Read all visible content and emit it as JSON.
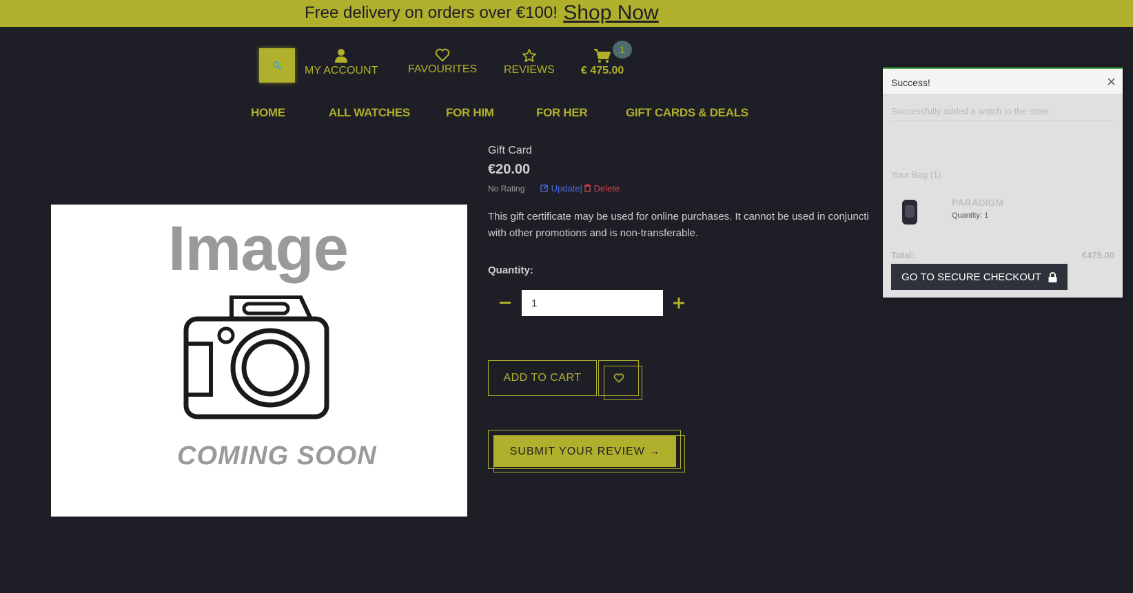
{
  "banner": {
    "text": "Free delivery on orders over €100!",
    "link": "Shop Now"
  },
  "header": {
    "search_icon": "search-icon",
    "my_account": "MY ACCOUNT",
    "favourites": "FAVOURITES",
    "reviews": "REVIEWS",
    "cart_total": "€ 475.00",
    "cart_count": "1"
  },
  "nav": {
    "items": [
      "HOME",
      "ALL WATCHES",
      "FOR HIM",
      "FOR HER",
      "GIFT CARDS & DEALS"
    ]
  },
  "image": {
    "word": "Image",
    "coming_soon": "COMING SOON"
  },
  "product": {
    "name": "Gift Card",
    "price": "€20.00",
    "rating": "No Rating",
    "update": "Update",
    "separator": "|",
    "delete": "Delete",
    "description": "This gift certificate may be used for online purchases. It cannot be used in conjuncti",
    "description_line2": "with other promotions and is non-transferable.",
    "quantity_label": "Quantity:",
    "quantity_value": "1",
    "add_to_cart": "ADD TO CART",
    "submit_review": "SUBMIT YOUR REVIEW →"
  },
  "toast": {
    "title": "Success!",
    "close": "×",
    "message": "Successfully added a watch to the store",
    "bag": "Your Bag (1)",
    "item_name": "PARADIGM",
    "item_qty": "Quantity: 1",
    "total_label": "Total:",
    "total_value": "€475.00",
    "checkout": "GO TO SECURE CHECKOUT"
  },
  "colors": {
    "accent": "#b0b02c",
    "background": "#1e1e27",
    "update_link": "#4f6be0",
    "delete_link": "#d0454a"
  }
}
